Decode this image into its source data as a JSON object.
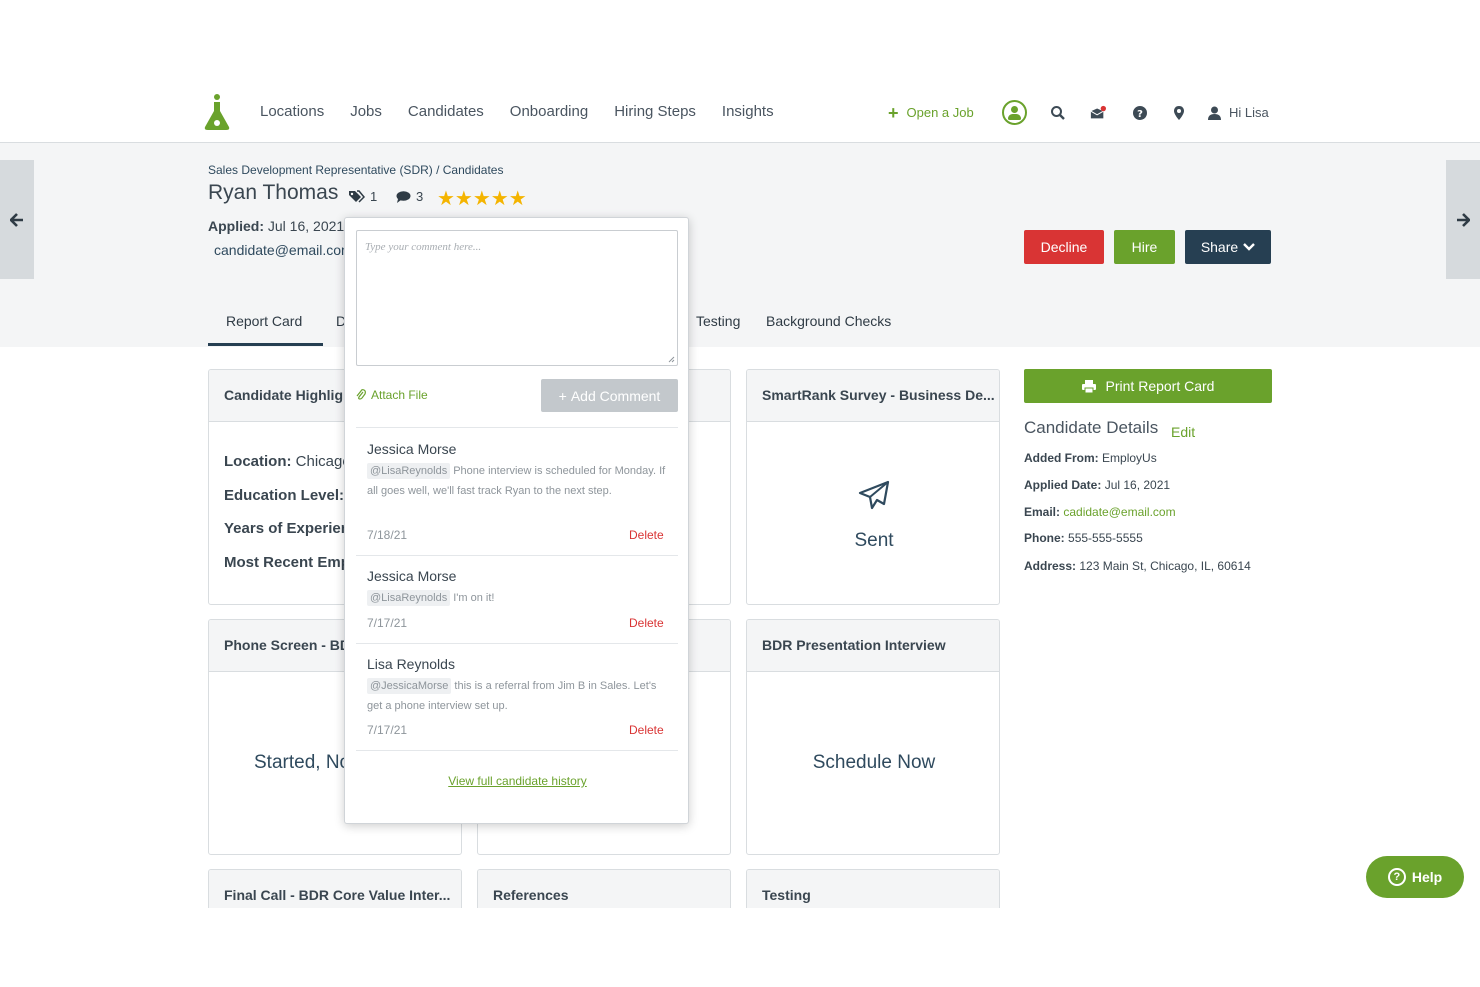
{
  "nav": {
    "links": [
      "Locations",
      "Jobs",
      "Candidates",
      "Onboarding",
      "Hiring Steps",
      "Insights"
    ],
    "open_job": "Open a Job",
    "greeting": "Hi Lisa"
  },
  "header": {
    "breadcrumb": "Sales Development Representative (SDR) / Candidates",
    "name": "Ryan Thomas",
    "tag_count": "1",
    "comment_count": "3",
    "rating": 5,
    "stars": "★★★★★",
    "applied_label": "Applied:",
    "applied_value": "Jul 16, 2021",
    "email": "candidate@email.com"
  },
  "actions": {
    "decline": "Decline",
    "hire": "Hire",
    "share": "Share"
  },
  "tabs": {
    "report_card": "Report Card",
    "d_partial": "D",
    "testing": "Testing",
    "background": "Background Checks"
  },
  "cards": {
    "highlights": {
      "title": "Candidate Highlights",
      "rows": [
        {
          "label": "Location:",
          "value": "Chicago"
        },
        {
          "label": "Education Level:",
          "value": ""
        },
        {
          "label": "Years of Experience",
          "value": ""
        },
        {
          "label": "Most Recent Employer",
          "value": ""
        }
      ]
    },
    "smartrank": {
      "title": "SmartRank Survey - Business De...",
      "status": "Sent"
    },
    "phone_screen": {
      "title": "Phone Screen - BDR",
      "status": "Started, Not"
    },
    "bdr_presentation": {
      "title": "BDR Presentation Interview",
      "status": "Schedule Now"
    },
    "final_call": {
      "title": "Final Call - BDR Core Value Inter..."
    },
    "references": {
      "title": "References"
    },
    "testing": {
      "title": "Testing"
    }
  },
  "details": {
    "print": "Print Report Card",
    "title": "Candidate Details",
    "edit": "Edit",
    "added_from_label": "Added From:",
    "added_from": "EmployUs",
    "applied_date_label": "Applied Date:",
    "applied_date": "Jul 16, 2021",
    "email_label": "Email:",
    "email": "cadidate@email.com",
    "phone_label": "Phone:",
    "phone": "555-555-5555",
    "address_label": "Address:",
    "address": "123 Main St, Chicago, IL, 60614"
  },
  "comments_popover": {
    "placeholder": "Type your comment here...",
    "attach": "Attach File",
    "add": "Add Comment",
    "delete": "Delete",
    "history": "View full candidate history",
    "items": [
      {
        "author": "Jessica Morse",
        "mention": "@LisaReynolds",
        "text": "Phone interview is scheduled for Monday. If all goes well, we'll fast track Ryan to the next step.",
        "date": "7/18/21"
      },
      {
        "author": "Jessica Morse",
        "mention": "@LisaReynolds",
        "text": "I'm on it!",
        "date": "7/17/21"
      },
      {
        "author": "Lisa Reynolds",
        "mention": "@JessicaMorse",
        "text": "this is a referral from Jim B in Sales. Let's get a phone interview set up.",
        "date": "7/17/21"
      }
    ]
  },
  "help": "Help",
  "colors": {
    "green": "#6aa22c",
    "red": "#d93434",
    "navy": "#263f52",
    "star": "#f4b400"
  }
}
